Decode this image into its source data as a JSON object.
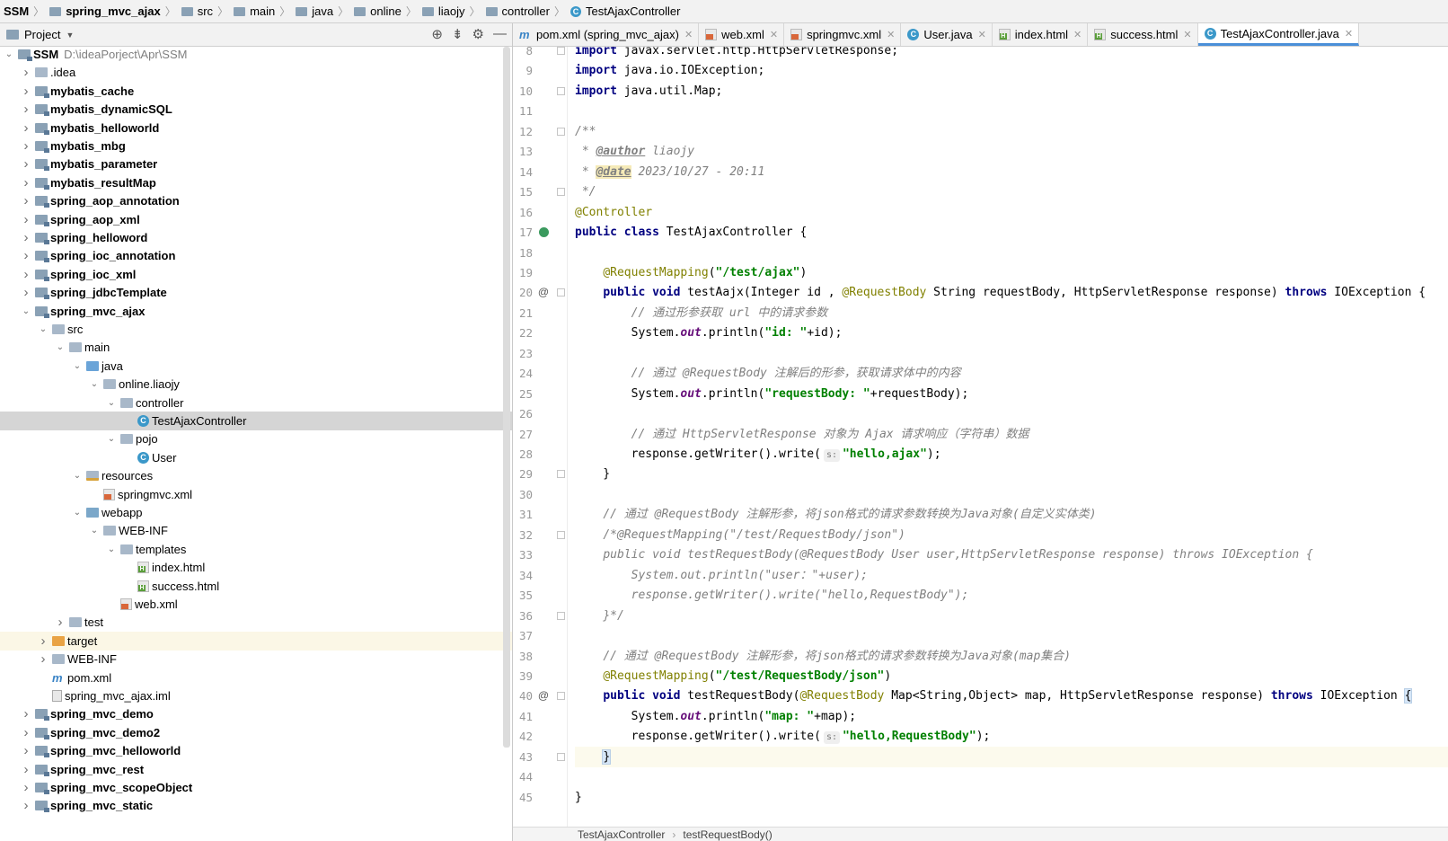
{
  "breadcrumb": [
    {
      "label": "SSM",
      "icon": "none",
      "bold": true
    },
    {
      "label": "spring_mvc_ajax",
      "icon": "module-icon",
      "bold": true
    },
    {
      "label": "src",
      "icon": "folder-icon",
      "bold": false
    },
    {
      "label": "main",
      "icon": "folder-icon",
      "bold": false
    },
    {
      "label": "java",
      "icon": "folder-icon",
      "bold": false
    },
    {
      "label": "online",
      "icon": "folder-icon",
      "bold": false
    },
    {
      "label": "liaojy",
      "icon": "folder-icon",
      "bold": false
    },
    {
      "label": "controller",
      "icon": "folder-icon",
      "bold": false
    },
    {
      "label": "TestAjaxController",
      "icon": "class-icon",
      "bold": false
    }
  ],
  "project_panel": {
    "title": "Project",
    "tree": [
      {
        "label": "SSM",
        "path": "D:\\ideaPorject\\Apr\\SSM",
        "depth": 0,
        "arrow": "expanded",
        "icon": "module-icon",
        "bold": true
      },
      {
        "label": ".idea",
        "depth": 1,
        "arrow": "collapsed",
        "icon": "folder-icon"
      },
      {
        "label": "mybatis_cache",
        "depth": 1,
        "arrow": "collapsed",
        "icon": "module-icon",
        "bold": true
      },
      {
        "label": "mybatis_dynamicSQL",
        "depth": 1,
        "arrow": "collapsed",
        "icon": "module-icon",
        "bold": true
      },
      {
        "label": "mybatis_helloworld",
        "depth": 1,
        "arrow": "collapsed",
        "icon": "module-icon",
        "bold": true
      },
      {
        "label": "mybatis_mbg",
        "depth": 1,
        "arrow": "collapsed",
        "icon": "module-icon",
        "bold": true
      },
      {
        "label": "mybatis_parameter",
        "depth": 1,
        "arrow": "collapsed",
        "icon": "module-icon",
        "bold": true
      },
      {
        "label": "mybatis_resultMap",
        "depth": 1,
        "arrow": "collapsed",
        "icon": "module-icon",
        "bold": true
      },
      {
        "label": "spring_aop_annotation",
        "depth": 1,
        "arrow": "collapsed",
        "icon": "module-icon",
        "bold": true
      },
      {
        "label": "spring_aop_xml",
        "depth": 1,
        "arrow": "collapsed",
        "icon": "module-icon",
        "bold": true
      },
      {
        "label": "spring_helloword",
        "depth": 1,
        "arrow": "collapsed",
        "icon": "module-icon",
        "bold": true
      },
      {
        "label": "spring_ioc_annotation",
        "depth": 1,
        "arrow": "collapsed",
        "icon": "module-icon",
        "bold": true
      },
      {
        "label": "spring_ioc_xml",
        "depth": 1,
        "arrow": "collapsed",
        "icon": "module-icon",
        "bold": true
      },
      {
        "label": "spring_jdbcTemplate",
        "depth": 1,
        "arrow": "collapsed",
        "icon": "module-icon",
        "bold": true
      },
      {
        "label": "spring_mvc_ajax",
        "depth": 1,
        "arrow": "expanded",
        "icon": "module-icon",
        "bold": true
      },
      {
        "label": "src",
        "depth": 2,
        "arrow": "expanded",
        "icon": "folder-icon"
      },
      {
        "label": "main",
        "depth": 3,
        "arrow": "expanded",
        "icon": "folder-icon"
      },
      {
        "label": "java",
        "depth": 4,
        "arrow": "expanded",
        "icon": "source-folder-icon"
      },
      {
        "label": "online.liaojy",
        "depth": 5,
        "arrow": "expanded",
        "icon": "package-icon"
      },
      {
        "label": "controller",
        "depth": 6,
        "arrow": "expanded",
        "icon": "package-icon"
      },
      {
        "label": "TestAjaxController",
        "depth": 7,
        "arrow": "none",
        "icon": "class-icon",
        "selected": true
      },
      {
        "label": "pojo",
        "depth": 6,
        "arrow": "expanded",
        "icon": "package-icon"
      },
      {
        "label": "User",
        "depth": 7,
        "arrow": "none",
        "icon": "class-icon"
      },
      {
        "label": "resources",
        "depth": 4,
        "arrow": "expanded",
        "icon": "resources-folder-icon"
      },
      {
        "label": "springmvc.xml",
        "depth": 5,
        "arrow": "none",
        "icon": "xml-file-icon"
      },
      {
        "label": "webapp",
        "depth": 4,
        "arrow": "expanded",
        "icon": "web-folder-icon"
      },
      {
        "label": "WEB-INF",
        "depth": 5,
        "arrow": "expanded",
        "icon": "folder-icon"
      },
      {
        "label": "templates",
        "depth": 6,
        "arrow": "expanded",
        "icon": "folder-icon"
      },
      {
        "label": "index.html",
        "depth": 7,
        "arrow": "none",
        "icon": "html-file-icon"
      },
      {
        "label": "success.html",
        "depth": 7,
        "arrow": "none",
        "icon": "html-file-icon"
      },
      {
        "label": "web.xml",
        "depth": 6,
        "arrow": "none",
        "icon": "xml-file-icon"
      },
      {
        "label": "test",
        "depth": 3,
        "arrow": "collapsed",
        "icon": "folder-icon"
      },
      {
        "label": "target",
        "depth": 2,
        "arrow": "collapsed",
        "icon": "excluded-folder-icon",
        "excluded": true
      },
      {
        "label": "WEB-INF",
        "depth": 2,
        "arrow": "collapsed",
        "icon": "folder-icon"
      },
      {
        "label": "pom.xml",
        "depth": 2,
        "arrow": "none",
        "icon": "maven-icon"
      },
      {
        "label": "spring_mvc_ajax.iml",
        "depth": 2,
        "arrow": "none",
        "icon": "iml-file-icon"
      },
      {
        "label": "spring_mvc_demo",
        "depth": 1,
        "arrow": "collapsed",
        "icon": "module-icon",
        "bold": true
      },
      {
        "label": "spring_mvc_demo2",
        "depth": 1,
        "arrow": "collapsed",
        "icon": "module-icon",
        "bold": true
      },
      {
        "label": "spring_mvc_helloworld",
        "depth": 1,
        "arrow": "collapsed",
        "icon": "module-icon",
        "bold": true
      },
      {
        "label": "spring_mvc_rest",
        "depth": 1,
        "arrow": "collapsed",
        "icon": "module-icon",
        "bold": true
      },
      {
        "label": "spring_mvc_scopeObject",
        "depth": 1,
        "arrow": "collapsed",
        "icon": "module-icon",
        "bold": true
      },
      {
        "label": "spring_mvc_static",
        "depth": 1,
        "arrow": "collapsed",
        "icon": "module-icon",
        "bold": true
      }
    ]
  },
  "tabs": [
    {
      "label": "pom.xml (spring_mvc_ajax)",
      "icon": "maven-icon",
      "active": false
    },
    {
      "label": "web.xml",
      "icon": "xml-file-icon",
      "active": false
    },
    {
      "label": "springmvc.xml",
      "icon": "xml-file-icon",
      "active": false
    },
    {
      "label": "User.java",
      "icon": "class-icon",
      "active": false
    },
    {
      "label": "index.html",
      "icon": "html-file-icon",
      "active": false
    },
    {
      "label": "success.html",
      "icon": "html-file-icon",
      "active": false
    },
    {
      "label": "TestAjaxController.java",
      "icon": "class-icon",
      "active": true
    }
  ],
  "editor": {
    "lines": [
      {
        "n": 8,
        "tokens": [
          [
            "k",
            "import"
          ],
          [
            "t",
            " javax.servlet.http.HttpServletResponse;"
          ]
        ],
        "fold": true
      },
      {
        "n": 9,
        "tokens": [
          [
            "k",
            "import"
          ],
          [
            "t",
            " java.io.IOException;"
          ]
        ]
      },
      {
        "n": 10,
        "tokens": [
          [
            "k",
            "import"
          ],
          [
            "t",
            " java.util.Map;"
          ]
        ],
        "fold": true
      },
      {
        "n": 11,
        "tokens": []
      },
      {
        "n": 12,
        "tokens": [
          [
            "c",
            "/**"
          ]
        ],
        "fold": true
      },
      {
        "n": 13,
        "tokens": [
          [
            "c",
            " * "
          ],
          [
            "doctag",
            "@author"
          ],
          [
            "c",
            " liaojy"
          ]
        ]
      },
      {
        "n": 14,
        "tokens": [
          [
            "c",
            " * "
          ],
          [
            "doctaghl",
            "@date"
          ],
          [
            "c",
            " 2023/10/27 - 20:11"
          ]
        ]
      },
      {
        "n": 15,
        "tokens": [
          [
            "c",
            " */"
          ]
        ],
        "fold": true
      },
      {
        "n": 16,
        "tokens": [
          [
            "an",
            "@Controller"
          ]
        ]
      },
      {
        "n": 17,
        "tokens": [
          [
            "k",
            "public class"
          ],
          [
            "t",
            " TestAjaxController {"
          ]
        ],
        "marker": "bean"
      },
      {
        "n": 18,
        "tokens": []
      },
      {
        "n": 19,
        "tokens": [
          [
            "t",
            "    "
          ],
          [
            "an",
            "@RequestMapping"
          ],
          [
            "t",
            "("
          ],
          [
            "s",
            "\"/test/ajax\""
          ],
          [
            "t",
            ")"
          ]
        ]
      },
      {
        "n": 20,
        "tokens": [
          [
            "t",
            "    "
          ],
          [
            "k",
            "public void"
          ],
          [
            "t",
            " testAajx(Integer id , "
          ],
          [
            "an",
            "@RequestBody"
          ],
          [
            "t",
            " String requestBody, HttpServletResponse response) "
          ],
          [
            "k",
            "throws"
          ],
          [
            "t",
            " IOException {"
          ]
        ],
        "marker": "at",
        "fold": true
      },
      {
        "n": 21,
        "tokens": [
          [
            "t",
            "        "
          ],
          [
            "c",
            "// 通过形参获取 url 中的请求参数"
          ]
        ]
      },
      {
        "n": 22,
        "tokens": [
          [
            "t",
            "        System."
          ],
          [
            "fld",
            "out"
          ],
          [
            "t",
            ".println("
          ],
          [
            "s",
            "\"id: \""
          ],
          [
            "t",
            "+id);"
          ]
        ]
      },
      {
        "n": 23,
        "tokens": []
      },
      {
        "n": 24,
        "tokens": [
          [
            "t",
            "        "
          ],
          [
            "c",
            "// 通过 @RequestBody 注解后的形参，获取请求体中的内容"
          ]
        ]
      },
      {
        "n": 25,
        "tokens": [
          [
            "t",
            "        System."
          ],
          [
            "fld",
            "out"
          ],
          [
            "t",
            ".println("
          ],
          [
            "s",
            "\"requestBody: \""
          ],
          [
            "t",
            "+requestBody);"
          ]
        ]
      },
      {
        "n": 26,
        "tokens": []
      },
      {
        "n": 27,
        "tokens": [
          [
            "t",
            "        "
          ],
          [
            "c",
            "// 通过 HttpServletResponse 对象为 Ajax 请求响应（字符串）数据"
          ]
        ]
      },
      {
        "n": 28,
        "tokens": [
          [
            "t",
            "        response.getWriter().write("
          ],
          [
            "hint",
            "s:"
          ],
          [
            "s",
            "\"hello,ajax\""
          ],
          [
            "t",
            ");"
          ]
        ]
      },
      {
        "n": 29,
        "tokens": [
          [
            "t",
            "    }"
          ]
        ],
        "fold": true
      },
      {
        "n": 30,
        "tokens": []
      },
      {
        "n": 31,
        "tokens": [
          [
            "t",
            "    "
          ],
          [
            "c",
            "// 通过 @RequestBody 注解形参，将json格式的请求参数转换为Java对象(自定义实体类)"
          ]
        ]
      },
      {
        "n": 32,
        "tokens": [
          [
            "t",
            "    "
          ],
          [
            "c",
            "/*@RequestMapping(\"/test/RequestBody/json\")"
          ]
        ],
        "fold": true
      },
      {
        "n": 33,
        "tokens": [
          [
            "t",
            "    "
          ],
          [
            "c",
            "public void testRequestBody(@RequestBody User user,HttpServletResponse response) throws IOException {"
          ]
        ]
      },
      {
        "n": 34,
        "tokens": [
          [
            "t",
            "        "
          ],
          [
            "c",
            "System.out.println(\"user：\"+user);"
          ]
        ]
      },
      {
        "n": 35,
        "tokens": [
          [
            "t",
            "        "
          ],
          [
            "c",
            "response.getWriter().write(\"hello,RequestBody\");"
          ]
        ]
      },
      {
        "n": 36,
        "tokens": [
          [
            "t",
            "    "
          ],
          [
            "c",
            "}*/"
          ]
        ],
        "fold": true
      },
      {
        "n": 37,
        "tokens": []
      },
      {
        "n": 38,
        "tokens": [
          [
            "t",
            "    "
          ],
          [
            "c",
            "// 通过 @RequestBody 注解形参，将json格式的请求参数转换为Java对象(map集合)"
          ]
        ]
      },
      {
        "n": 39,
        "tokens": [
          [
            "t",
            "    "
          ],
          [
            "an",
            "@RequestMapping"
          ],
          [
            "t",
            "("
          ],
          [
            "s",
            "\"/test/RequestBody/json\""
          ],
          [
            "t",
            ")"
          ]
        ]
      },
      {
        "n": 40,
        "tokens": [
          [
            "t",
            "    "
          ],
          [
            "k",
            "public void"
          ],
          [
            "t",
            " testRequestBody("
          ],
          [
            "an",
            "@RequestBody"
          ],
          [
            "t",
            " Map<String,Object> map, HttpServletResponse response) "
          ],
          [
            "k",
            "throws"
          ],
          [
            "t",
            " IOException "
          ],
          [
            "bracehl",
            "{"
          ]
        ],
        "marker": "at",
        "fold": true
      },
      {
        "n": 41,
        "tokens": [
          [
            "t",
            "        System."
          ],
          [
            "fld",
            "out"
          ],
          [
            "t",
            ".println("
          ],
          [
            "s",
            "\"map: \""
          ],
          [
            "t",
            "+map);"
          ]
        ]
      },
      {
        "n": 42,
        "tokens": [
          [
            "t",
            "        response.getWriter().write("
          ],
          [
            "hint",
            "s:"
          ],
          [
            "s",
            "\"hello,RequestBody\""
          ],
          [
            "t",
            ");"
          ]
        ]
      },
      {
        "n": 43,
        "tokens": [
          [
            "t",
            "    "
          ],
          [
            "bracehl",
            "}"
          ]
        ],
        "fold": true,
        "caret": true
      },
      {
        "n": 44,
        "tokens": []
      },
      {
        "n": 45,
        "tokens": [
          [
            "t",
            "}"
          ]
        ]
      }
    ]
  },
  "status_breadcrumb": [
    "TestAjaxController",
    "testRequestBody()"
  ],
  "colors": {
    "keyword": "#000080",
    "string": "#008000",
    "annotation": "#808000",
    "comment": "#808080",
    "static_field": "#660e7a",
    "active_tab_underline": "#4a8fd8",
    "selection": "#d5d5d5"
  }
}
